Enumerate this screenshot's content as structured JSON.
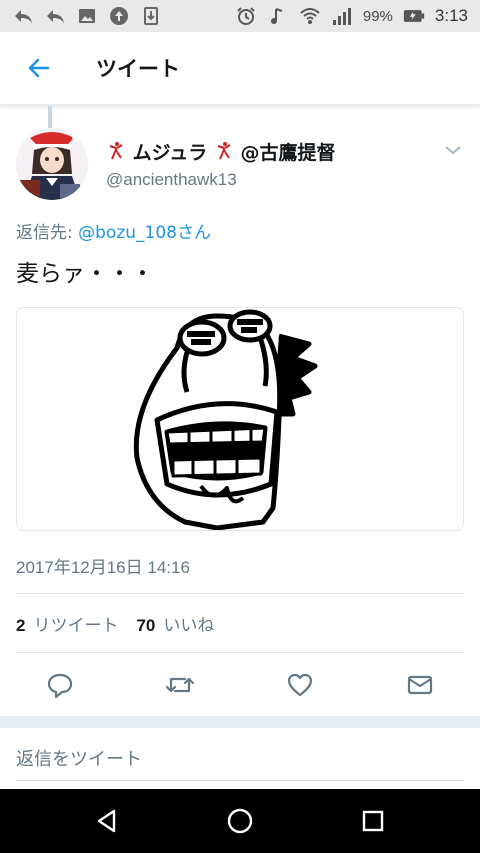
{
  "status_bar": {
    "battery_percent": "99%",
    "time": "3:13"
  },
  "app_bar": {
    "title": "ツイート"
  },
  "tweet": {
    "user_name": "ムジュラ",
    "user_name_suffix": "@古鷹提督",
    "handle": "@ancienthawk13",
    "reply_prefix": "返信先: ",
    "reply_mention": "@bozu_108さん",
    "text": "麦らァ・・・",
    "timestamp": "2017年12月16日 14:16",
    "stats": {
      "retweets_count": "2",
      "retweets_label": "リツイート",
      "likes_count": "70",
      "likes_label": "いいね"
    }
  },
  "reply_box": {
    "placeholder": "返信をツイート"
  },
  "colors": {
    "accent": "#1b95e0",
    "secondary_text": "#657786",
    "divider": "#e1e8ed"
  }
}
